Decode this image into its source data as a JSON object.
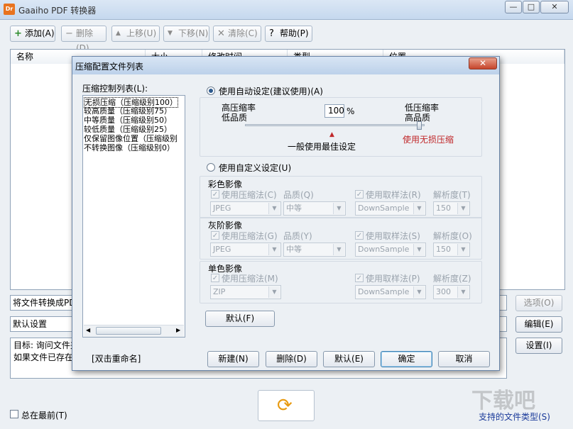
{
  "window": {
    "title": "Gaaiho PDF 转换器",
    "app_icon": "Dr",
    "minimize": "—",
    "maximize": "□",
    "close": "✕"
  },
  "toolbar": {
    "add": "添加(A)",
    "remove": "删除(D)",
    "move_up": "上移(U)",
    "move_down": "下移(N)",
    "clear": "清除(C)",
    "help": "帮助(P)"
  },
  "file_list": {
    "columns": [
      "名称",
      "大小",
      "修改时间",
      "类型",
      "位置"
    ]
  },
  "convert_to": {
    "value": "将文件转换成PD",
    "options_button": "选项(O)"
  },
  "preset": {
    "value": "默认设置",
    "edit_button": "编辑(E)"
  },
  "message": {
    "line1": "目标: 询问文件夹",
    "line2": "如果文件已存在",
    "settings_button": "设置(I)"
  },
  "always_on_top": "总在最前(T)",
  "supported_types": "支持的文件类型(S)",
  "dialog": {
    "title": "压缩配置文件列表",
    "list_label": "压缩控制列表(L):",
    "list_items": [
      "无损压缩（压缩级别100）",
      "较高质量（压缩级别75）",
      "中等质量（压缩级别50）",
      "较低质量（压缩级别25）",
      "仅保留图像位置（压缩级别",
      "不转换图像（压缩级别0）"
    ],
    "selected_index": 0,
    "rename_hint": "[双击重命名]",
    "auto_radio": "使用自动设定(建议使用)(A)",
    "high_compress_1": "高压缩率",
    "high_compress_2": "低品质",
    "low_compress_1": "低压缩率",
    "low_compress_2": "高品质",
    "percent_value": "100",
    "percent_unit": "%",
    "best_setting": "一般使用最佳设定",
    "lossless_label": "使用无损压缩",
    "custom_radio": "使用自定义设定(U)",
    "color": {
      "title": "彩色影像",
      "use_compress": "使用压缩法(C)",
      "quality_label": "品质(Q)",
      "use_sample": "使用取样法(R)",
      "resolution_label": "解析度(T)",
      "method": "JPEG",
      "quality": "中等",
      "sample": "DownSample",
      "resolution": "150"
    },
    "gray": {
      "title": "灰阶影像",
      "use_compress": "使用压缩法(G)",
      "quality_label": "品质(Y)",
      "use_sample": "使用取样法(S)",
      "resolution_label": "解析度(O)",
      "method": "JPEG",
      "quality": "中等",
      "sample": "DownSample",
      "resolution": "150"
    },
    "mono": {
      "title": "单色影像",
      "use_compress": "使用压缩法(M)",
      "use_sample": "使用取样法(P)",
      "resolution_label": "解析度(Z)",
      "method": "ZIP",
      "sample": "DownSample",
      "resolution": "300"
    },
    "default_button": "默认(F)",
    "new_button": "新建(N)",
    "delete_button": "删除(D)",
    "reset_button": "默认(E)",
    "ok_button": "确定",
    "cancel_button": "取消",
    "accent_red": "#c0282a"
  },
  "watermark": "下载吧"
}
